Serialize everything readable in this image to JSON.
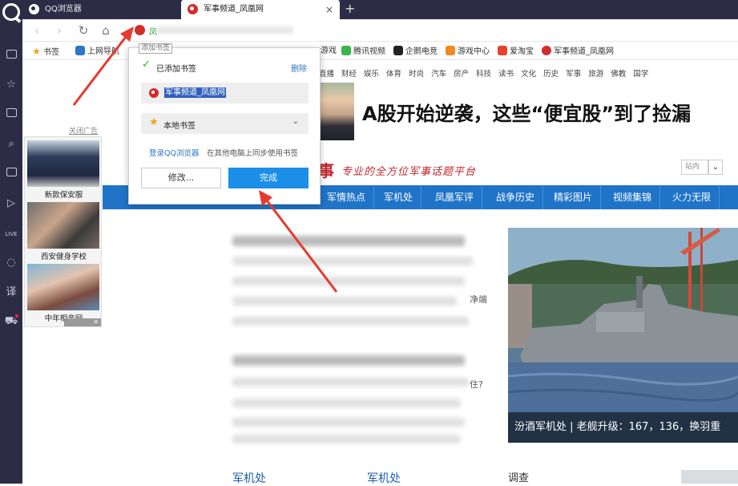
{
  "tabs": [
    {
      "label": "QQ浏览器"
    },
    {
      "label": "军事频道_凤凰网",
      "close": "×"
    }
  ],
  "new_tab": "+",
  "address": {
    "visible_text": "凤"
  },
  "tooltip": "添加书签",
  "bookmarks_bar": [
    {
      "label": "书签",
      "icon": "star-icon"
    },
    {
      "label": "上网导航",
      "icon": "ie-icon"
    },
    {
      "label": "游戏",
      "icon": "game-icon"
    },
    {
      "label": "腾讯视频",
      "icon": "video-icon"
    },
    {
      "label": "企鹅电竞",
      "icon": "penguin-icon"
    },
    {
      "label": "游戏中心",
      "icon": "gamepad-icon"
    },
    {
      "label": "爱淘宝",
      "icon": "taobao-icon"
    },
    {
      "label": "军事频道_凤凰网",
      "icon": "ifeng-icon"
    }
  ],
  "popup": {
    "added_label": "已添加书签",
    "delete_label": "删除",
    "bookmark_name": "军事频道_凤凰网",
    "folder": "本地书签",
    "login_link": "登录QQ浏览器",
    "sync_text": "在其他电脑上同步使用书签",
    "edit_button": "修改...",
    "done_button": "完成"
  },
  "page": {
    "categories": [
      "直播",
      "财经",
      "娱乐",
      "体育",
      "时尚",
      "汽车",
      "房产",
      "科技",
      "读书",
      "文化",
      "历史",
      "军事",
      "旅游",
      "佛教",
      "国学"
    ],
    "headline": "A股开始逆袭，这些“便宜股”到了捡漏",
    "ad_close_label": "关闭广告",
    "ads": [
      {
        "caption": "新款保安服"
      },
      {
        "caption": "西安健身学校"
      },
      {
        "caption": "中年相亲网"
      }
    ],
    "ad_close_x": "✕",
    "logo_char": "事",
    "tagline": "专业的全方位军事话题平台",
    "site_search": "站内",
    "nav": [
      "军情热点",
      "军机处",
      "凤凰军评",
      "战争历史",
      "精彩图片",
      "视频集锦",
      "火力无限"
    ],
    "frag1": "净端",
    "frag2": "住?",
    "image_caption": "汾酒军机处 | 老舰升级：167，136，换羽重",
    "sections": [
      "军机处",
      "军机处"
    ],
    "survey": "调查"
  },
  "colors": {
    "accent_blue": "#1b8fe8",
    "nav_blue": "#1f74c8",
    "ifeng_red": "#c0272d",
    "sidebar": "#2c2c46"
  }
}
